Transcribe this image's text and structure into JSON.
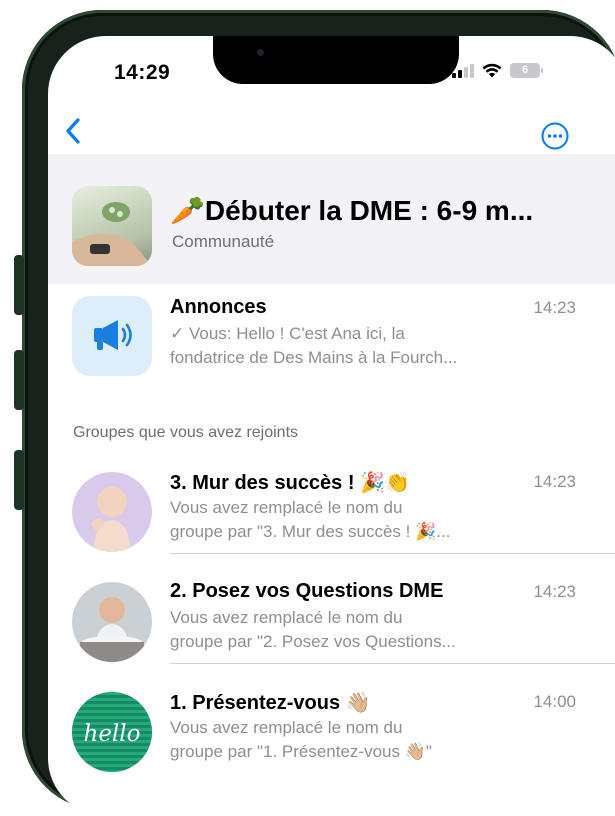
{
  "status_bar": {
    "time": "14:29",
    "battery": "6"
  },
  "community": {
    "title": "🥕Débuter la DME : 6-9 m...",
    "subtitle": "Communauté"
  },
  "announcements": {
    "title": "Annonces",
    "time": "14:23",
    "line1": "✓ Vous: Hello ! C'est Ana ici, la",
    "line2": "fondatrice de Des Mains à la Fourch..."
  },
  "section_label": "Groupes que vous avez rejoints",
  "groups": [
    {
      "title": "3. Mur des succès ! 🎉👏",
      "time": "14:23",
      "line1": "Vous avez remplacé le nom du",
      "line2": "groupe par \"3. Mur des succès ! 🎉..."
    },
    {
      "title": "2. Posez vos Questions DME",
      "time": "14:23",
      "line1": "Vous avez remplacé le nom du",
      "line2": "groupe par \"2. Posez vos Questions..."
    },
    {
      "title": "1. Présentez-vous 👋🏼",
      "time": "14:00",
      "line1": "Vous avez remplacé le nom du",
      "line2": "groupe par \"1. Présentez-vous 👋🏼\"",
      "avatar_text": "hello"
    }
  ],
  "icons": {
    "back": "chevron-left-icon",
    "more": "ellipsis-circle-icon",
    "announcements": "megaphone-icon"
  },
  "colors": {
    "accent": "#007aff",
    "header_bg": "#f2f2f7",
    "frame": "#17221a"
  }
}
